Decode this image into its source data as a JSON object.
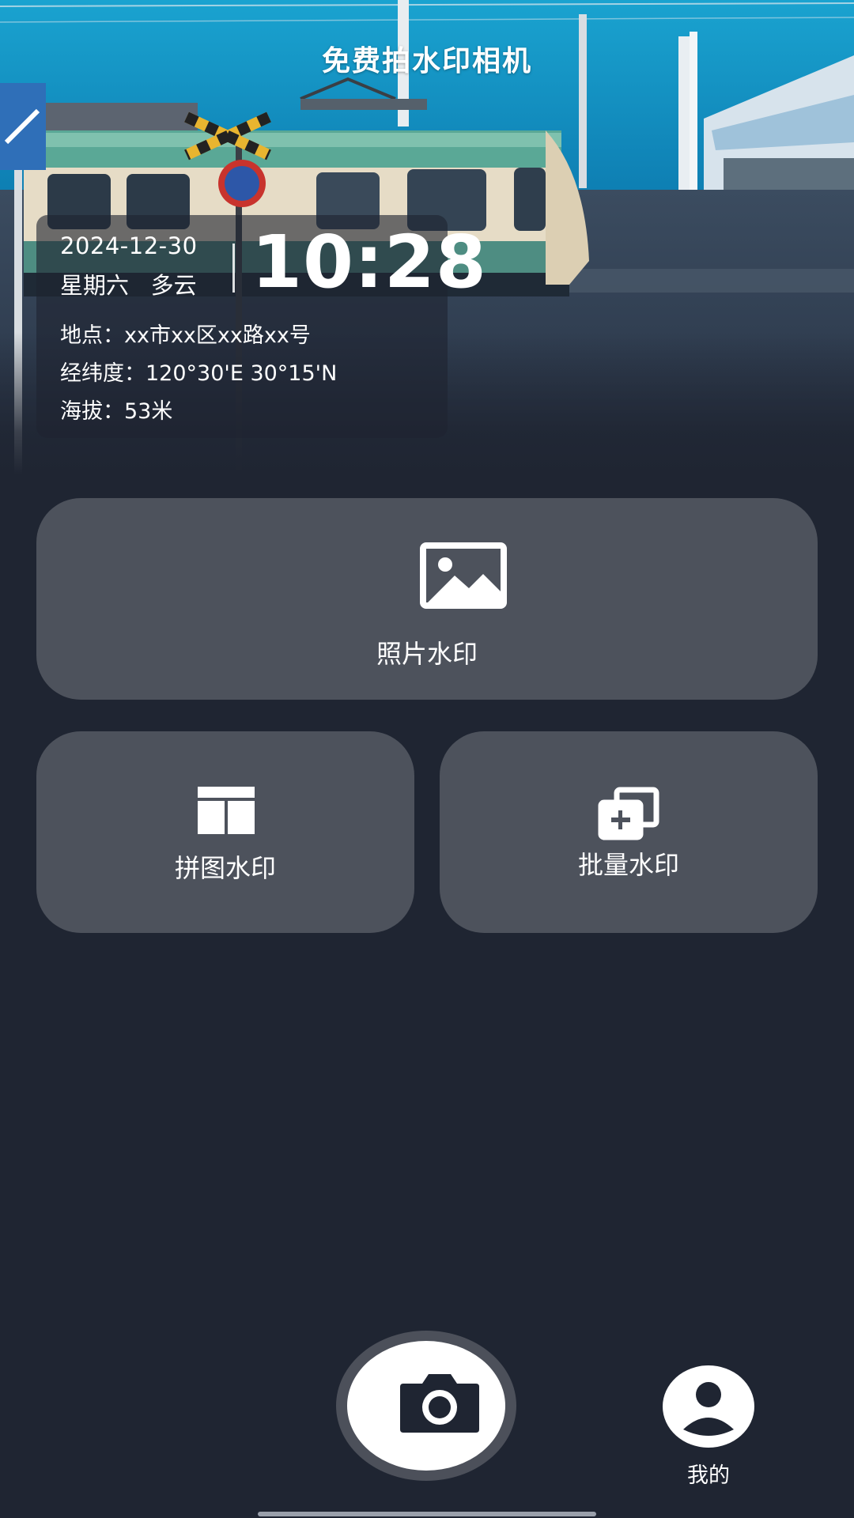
{
  "app": {
    "title": "免费拍水印相机"
  },
  "watermark": {
    "date": "2024-12-30",
    "weekday_weather": "星期六   多云",
    "time": "10:28",
    "location": "地点：xx市xx区xx路xx号",
    "coordinates": "经纬度：120°30'E 30°15'N",
    "altitude": "海拔：53米"
  },
  "features": {
    "photo": {
      "label": "照片水印",
      "icon": "image-icon"
    },
    "collage": {
      "label": "拼图水印",
      "icon": "layout-icon"
    },
    "batch": {
      "label": "批量水印",
      "icon": "add-multiple-icon"
    }
  },
  "bottom_bar": {
    "shutter_icon": "camera-icon",
    "profile": {
      "label": "我的",
      "icon": "user-icon"
    }
  },
  "colors": {
    "background": "#1f2532",
    "card": "#4d525c",
    "text": "#ffffff"
  }
}
